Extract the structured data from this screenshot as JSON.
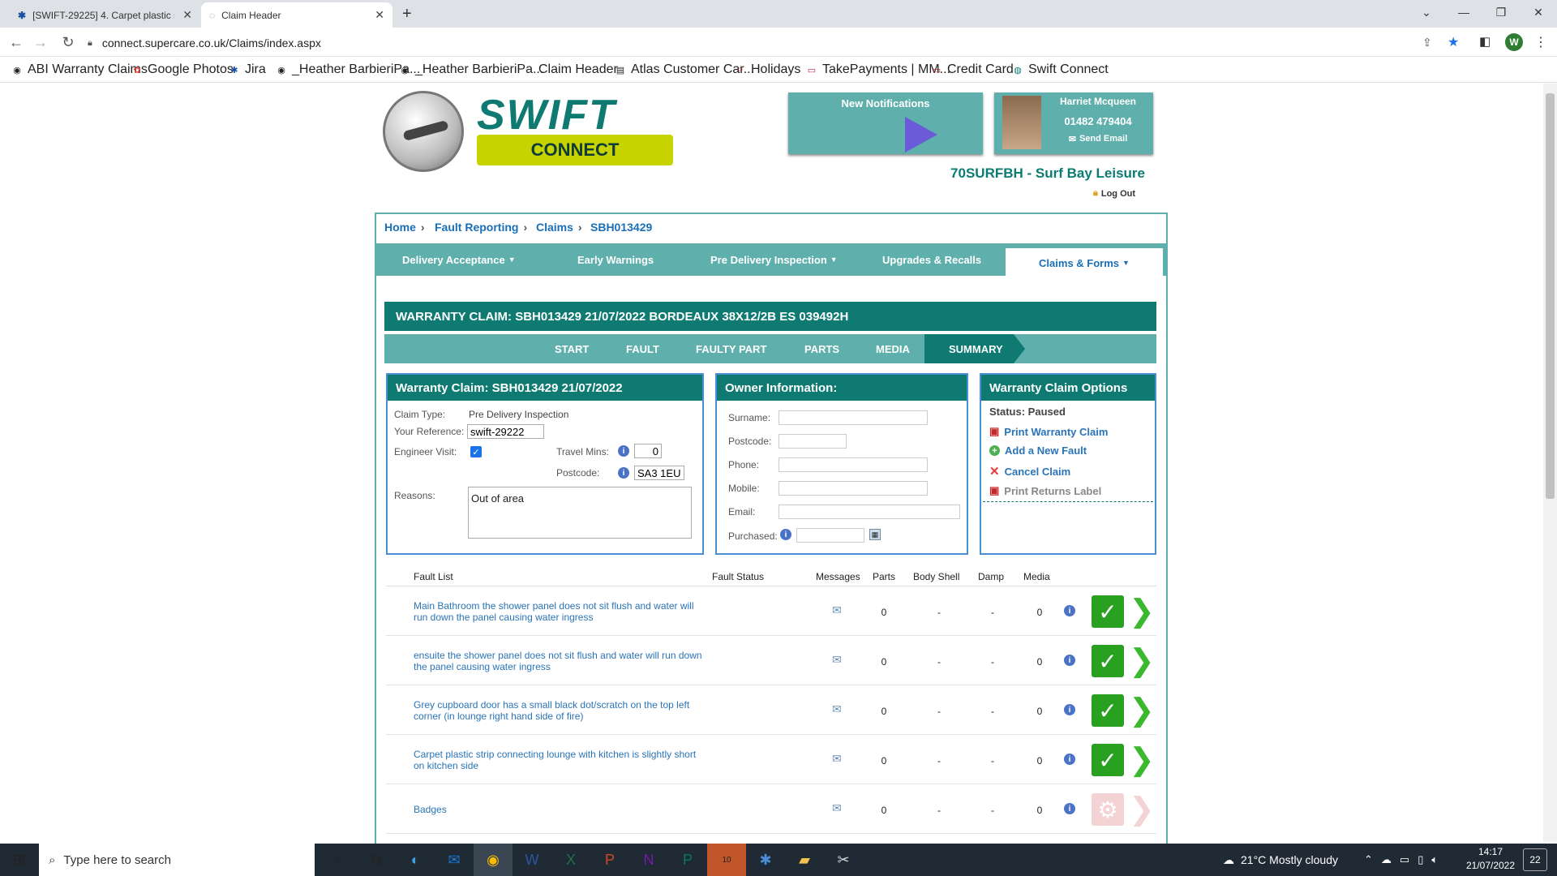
{
  "browser": {
    "tabs": [
      {
        "title": "[SWIFT-29225] 4. Carpet plastic s",
        "active": false
      },
      {
        "title": "Claim Header",
        "active": true
      }
    ],
    "url": "connect.supercare.co.uk/Claims/index.aspx",
    "profile_initial": "W",
    "bookmarks": [
      "ABI Warranty Claims",
      "Google Photos",
      "Jira",
      "_Heather BarbieriPa...",
      "_Heather BarbieriPa...",
      "Claim Header",
      "Atlas Customer Car...",
      "Holidays",
      "TakePayments | MM...",
      "Credit Card",
      "Swift Connect"
    ]
  },
  "header": {
    "logo_top": "SWIFT",
    "logo_bottom": "CONNECT",
    "notifications_title": "New Notifications",
    "user_name": "Harriet Mcqueen",
    "user_phone": "01482 479404",
    "send_email": "Send Email",
    "dealer": "70SURFBH - Surf Bay Leisure",
    "logout": "Log Out"
  },
  "breadcrumb": [
    "Home",
    "Fault Reporting",
    "Claims",
    "SBH013429"
  ],
  "nav_tabs": [
    "Delivery Acceptance",
    "Early Warnings",
    "Pre Delivery Inspection",
    "Upgrades & Recalls",
    "Claims & Forms"
  ],
  "claim_banner": "WARRANTY CLAIM: SBH013429 21/07/2022 BORDEAUX 38X12/2B ES 039492H",
  "steps": [
    "START",
    "FAULT",
    "FAULTY PART",
    "PARTS",
    "MEDIA",
    "SUMMARY"
  ],
  "claim_panel": {
    "title": "Warranty Claim: SBH013429 21/07/2022",
    "claim_type_label": "Claim Type:",
    "claim_type_value": "Pre Delivery Inspection",
    "reference_label": "Your Reference:",
    "reference_value": "swift-29222",
    "engineer_label": "Engineer Visit:",
    "travel_label": "Travel Mins:",
    "travel_value": "0",
    "postcode_label": "Postcode:",
    "postcode_value": "SA3 1EU",
    "reasons_label": "Reasons:",
    "reasons_value": "Out of area"
  },
  "owner_panel": {
    "title": "Owner Information:",
    "surname": "Surname:",
    "postcode": "Postcode:",
    "phone": "Phone:",
    "mobile": "Mobile:",
    "email": "Email:",
    "purchased": "Purchased:"
  },
  "options_panel": {
    "title": "Warranty Claim Options",
    "status": "Status: Paused",
    "print_claim": "Print Warranty Claim",
    "add_fault": "Add a New Fault",
    "cancel_claim": "Cancel Claim",
    "print_returns": "Print Returns Label"
  },
  "fault_table": {
    "headers": [
      "Fault List",
      "Fault Status",
      "Messages",
      "Parts",
      "Body Shell",
      "Damp",
      "Media"
    ],
    "rows": [
      {
        "text": "Main Bathroom the shower panel does not sit flush and water will run down the panel causing water ingress",
        "parts": "0",
        "body": "-",
        "damp": "-",
        "media": "0",
        "complete": true
      },
      {
        "text": "ensuite the shower panel does not sit flush and water will run down the panel causing water ingress",
        "parts": "0",
        "body": "-",
        "damp": "-",
        "media": "0",
        "complete": true
      },
      {
        "text": "Grey cupboard door has a small black dot/scratch on the top left corner (in lounge right hand side of fire)",
        "parts": "0",
        "body": "-",
        "damp": "-",
        "media": "0",
        "complete": true
      },
      {
        "text": "Carpet plastic strip connecting lounge with kitchen is slightly short on kitchen side",
        "parts": "0",
        "body": "-",
        "damp": "-",
        "media": "0",
        "complete": true
      },
      {
        "text": "Badges",
        "parts": "0",
        "body": "-",
        "damp": "-",
        "media": "0",
        "complete": false
      }
    ]
  },
  "taskbar": {
    "search_placeholder": "Type here to search",
    "weather": "21°C  Mostly cloudy",
    "time": "14:17",
    "date": "21/07/2022",
    "notif_count": "22",
    "outlook_badge": "10"
  },
  "colors": {
    "teal": "#0e7a72",
    "light_teal": "#5fb0ac",
    "lime": "#c8d400",
    "link": "#2a74b8"
  }
}
